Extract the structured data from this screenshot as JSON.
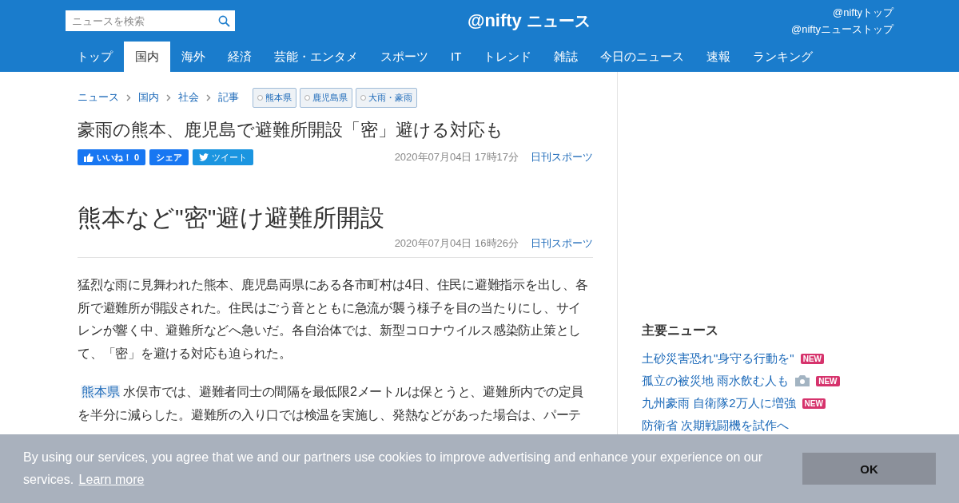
{
  "header": {
    "search": {
      "placeholder": "ニュースを検索"
    },
    "logo": {
      "brand": "@nifty",
      "service": "ニュース"
    },
    "links": [
      "@niftyトップ",
      "@niftyニューストップ"
    ]
  },
  "nav": [
    {
      "label": "トップ",
      "selected": false
    },
    {
      "label": "国内",
      "selected": true
    },
    {
      "label": "海外",
      "selected": false
    },
    {
      "label": "経済",
      "selected": false
    },
    {
      "label": "芸能・エンタメ",
      "selected": false
    },
    {
      "label": "スポーツ",
      "selected": false
    },
    {
      "label": "IT",
      "selected": false
    },
    {
      "label": "トレンド",
      "selected": false
    },
    {
      "label": "雑誌",
      "selected": false
    },
    {
      "label": "今日のニュース",
      "selected": false
    },
    {
      "label": "速報",
      "selected": false
    },
    {
      "label": "ランキング",
      "selected": false
    }
  ],
  "breadcrumbs": [
    "ニュース",
    "国内",
    "社会",
    "記事"
  ],
  "tags": [
    "熊本県",
    "鹿児島県",
    "大雨・豪雨"
  ],
  "headline": "豪雨の熊本、鹿児島で避難所開設「密」避ける対応も",
  "social": [
    {
      "kind": "like",
      "label": "いいね！ 0"
    },
    {
      "kind": "share",
      "label": "シェア"
    },
    {
      "kind": "tweet",
      "label": "ツイート"
    }
  ],
  "meta": {
    "date": "2020年07月04日 17時17分",
    "source": "日刊スポーツ"
  },
  "article": {
    "title": "熊本など\"密\"避け避難所開設",
    "date": "2020年07月04日 16時26分",
    "source": "日刊スポーツ",
    "paragraphs": [
      [
        {
          "text": "猛烈な雨に見舞われた熊本、鹿児島両県にある各市町村は4日、住民に避難指示を出し、各所で避難所が開設された。住民はごう音とともに急流が襲う様子を目の当たりにし、サイレンが響く中、避難所などへ急いだ。各自治体では、新型コロナウイルス感染防止策として、「密」を避ける対応も迫られた。",
          "kind": "text"
        }
      ],
      [
        {
          "text": "熊本県",
          "kind": "link"
        },
        {
          "text": " 水俣市では、避難者同士の間隔を最低限2メートルは保とうと、避難所内での定員を半分に減らした。避難所の入り口では検温を実施し、発熱などがあった場合は、パーテ",
          "kind": "text"
        }
      ]
    ]
  },
  "sidebar": {
    "heading": "主要ニュース",
    "items": [
      {
        "title": "土砂災害恐れ\"身守る行動を\"",
        "photo": false,
        "badge": "NEW"
      },
      {
        "title": "孤立の被災地 雨水飲む人も",
        "photo": true,
        "badge": "NEW"
      },
      {
        "title": "九州豪雨 自衛隊2万人に増強",
        "photo": false,
        "badge": "NEW"
      },
      {
        "title": "防衛省 次期戦闘機を試作へ",
        "photo": false
      }
    ]
  },
  "cookie": {
    "text": "By using our services, you agree that we and our partners use cookies to improve advertising and enhance your experience on our services.",
    "link": "Learn more",
    "button": "OK"
  }
}
